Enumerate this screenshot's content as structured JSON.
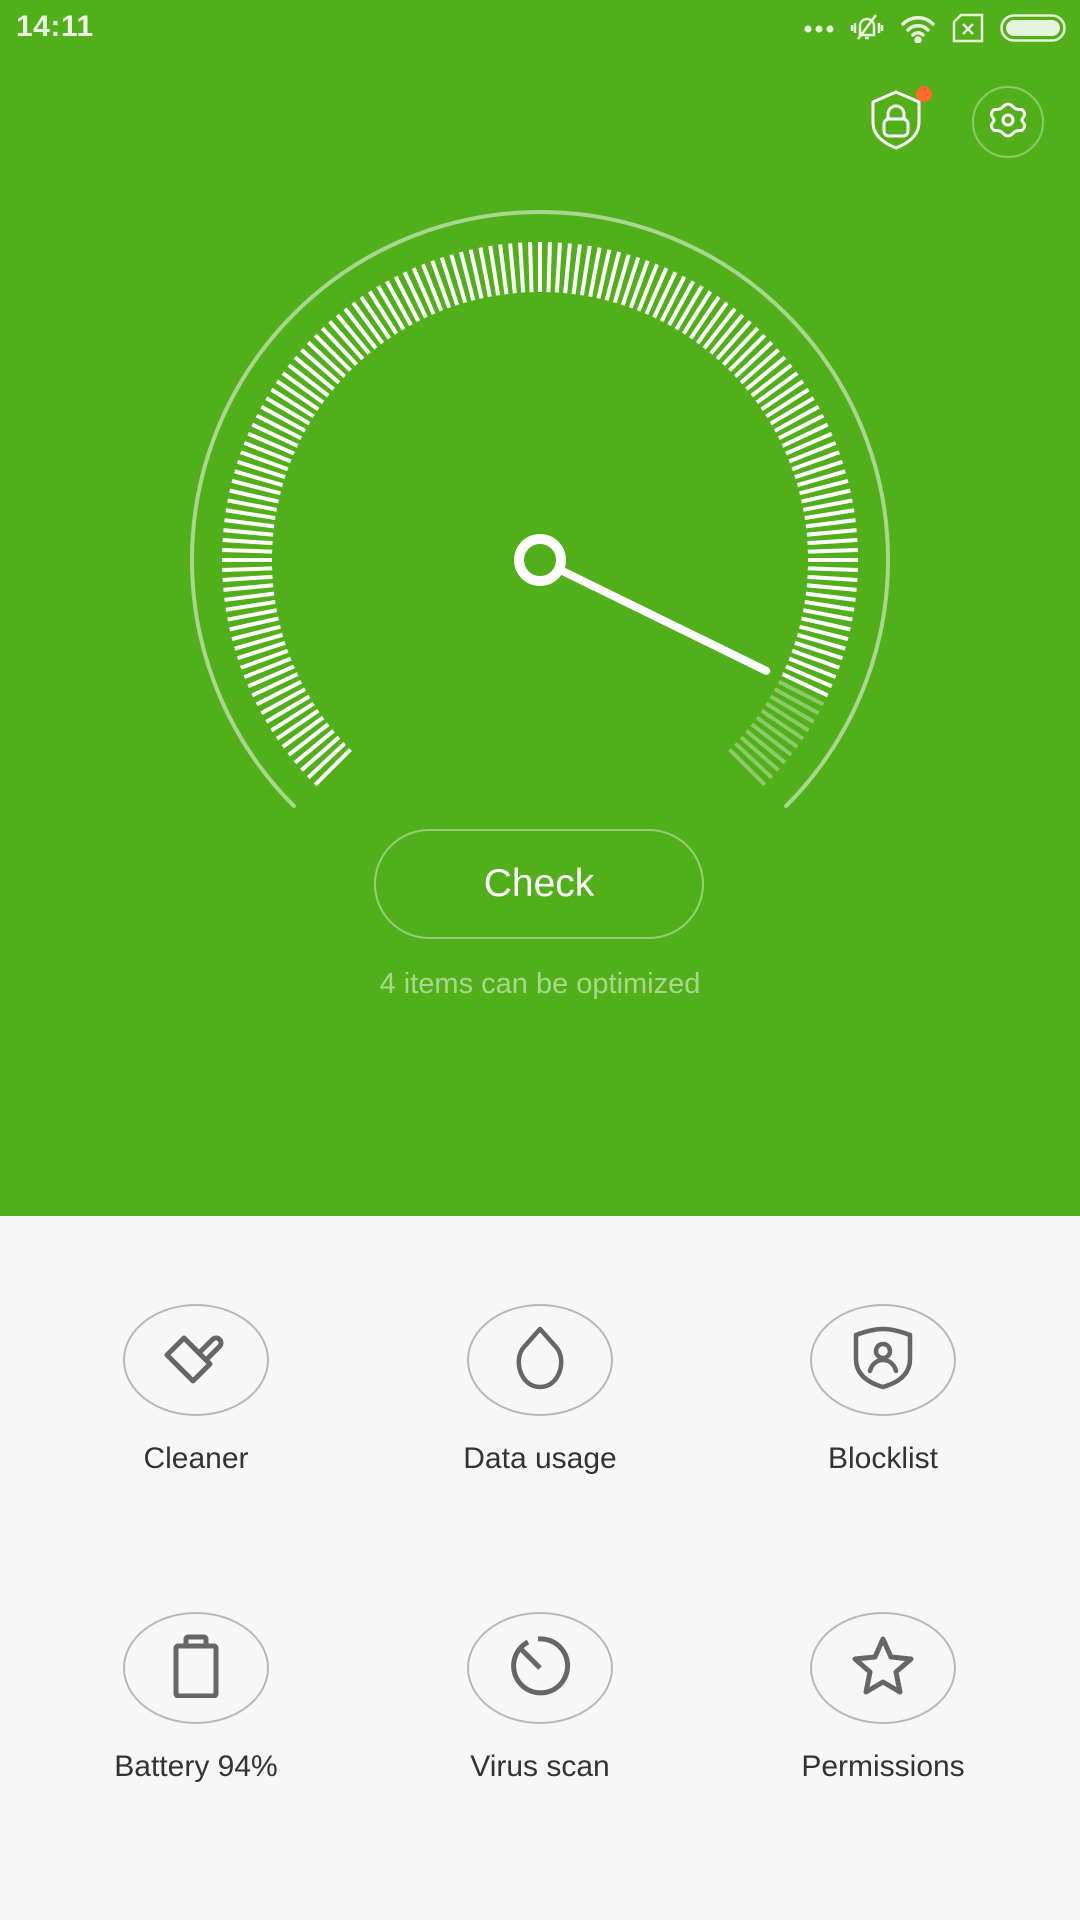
{
  "status_bar": {
    "time": "14:11",
    "icons": [
      "more-dots-icon",
      "vibrate-silent-icon",
      "wifi-icon",
      "no-sim-icon",
      "battery-icon"
    ]
  },
  "header": {
    "security_lock_icon": "shield-lock-icon",
    "has_notification": true,
    "settings_icon": "gear-icon"
  },
  "gauge": {
    "value_fraction": 0.93,
    "tick_count": 150,
    "start_angle_deg": -135,
    "sweep_deg": 270
  },
  "main": {
    "check_label": "Check",
    "status_text": "4 items can be optimized"
  },
  "features": [
    {
      "label": "Cleaner",
      "icon": "brush-icon"
    },
    {
      "label": "Data usage",
      "icon": "droplet-icon"
    },
    {
      "label": "Blocklist",
      "icon": "shield-user-icon"
    },
    {
      "label": "Battery 94%",
      "icon": "battery-icon"
    },
    {
      "label": "Virus scan",
      "icon": "scan-dial-icon"
    },
    {
      "label": "Permissions",
      "icon": "star-icon"
    }
  ],
  "colors": {
    "primary_green": "#51af1a",
    "notification_dot": "#ff6a2d",
    "background": "#f7f7f7",
    "icon_grey": "#666666"
  }
}
